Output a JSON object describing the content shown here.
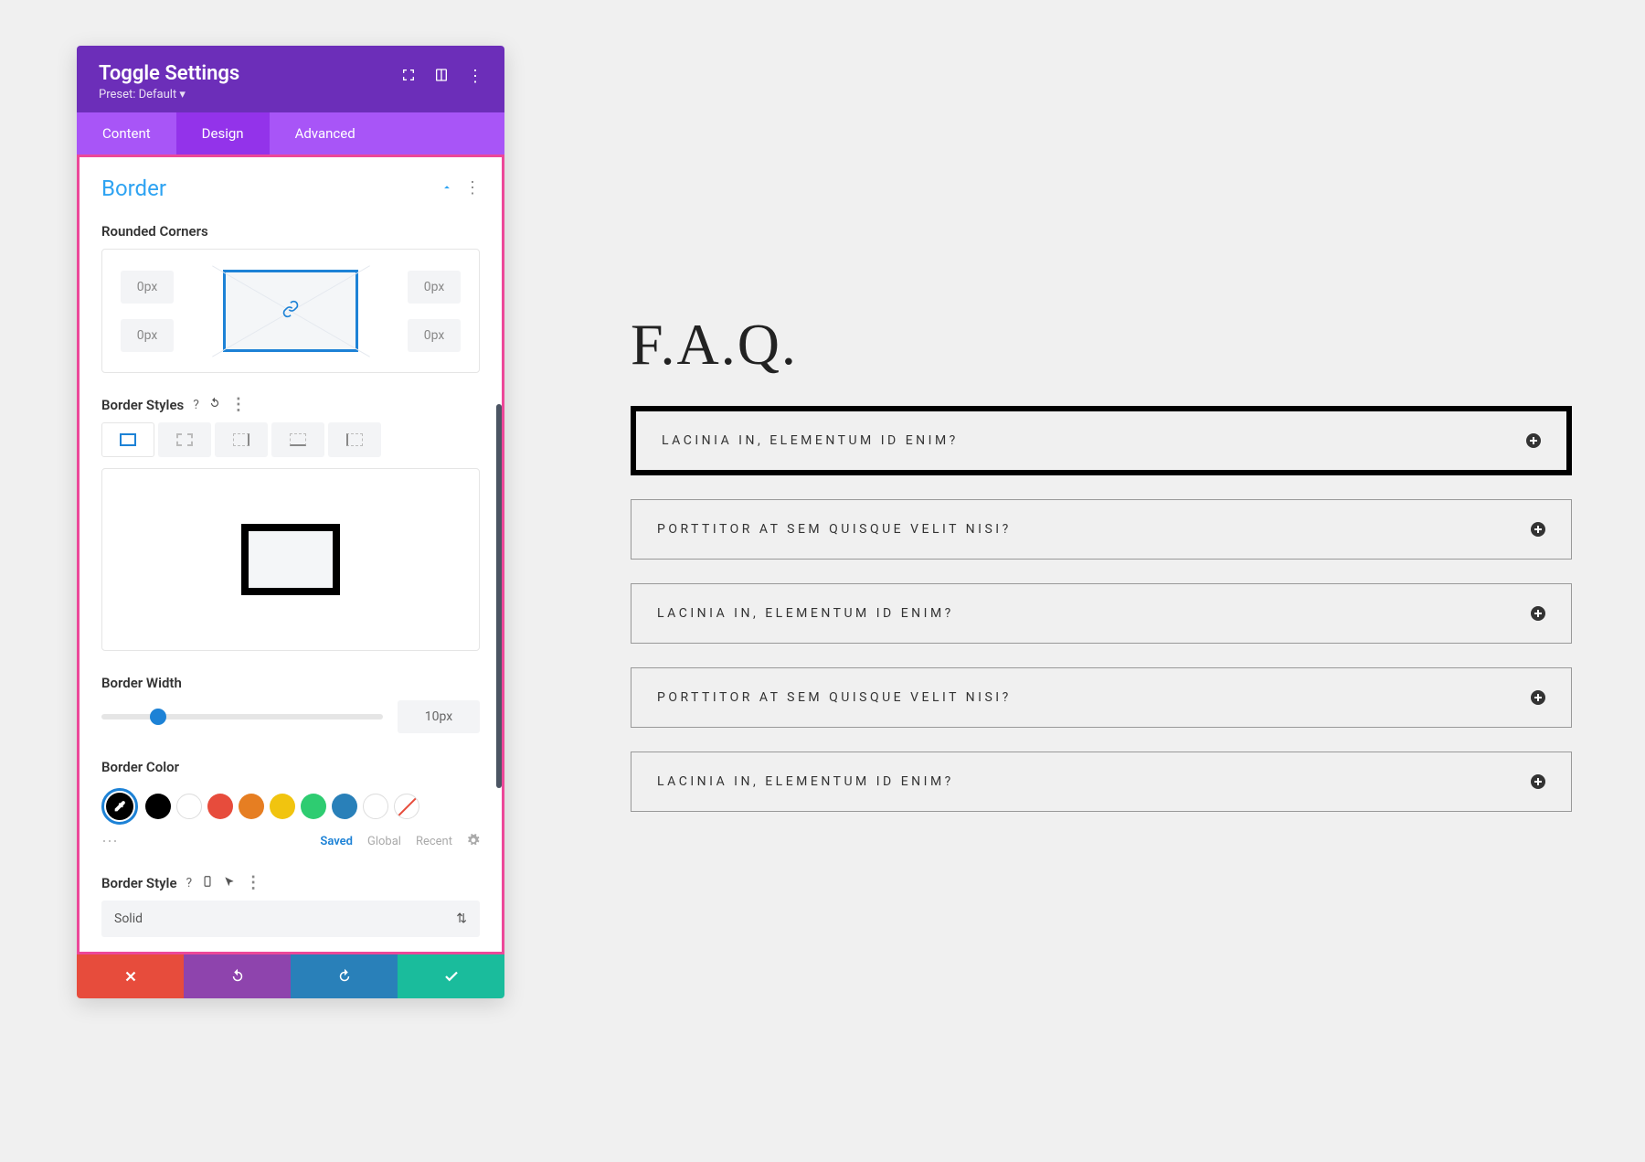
{
  "panel": {
    "title": "Toggle Settings",
    "preset": "Preset: Default ▾",
    "tabs": [
      "Content",
      "Design",
      "Advanced"
    ],
    "section": "Border",
    "rounded_label": "Rounded Corners",
    "corner": {
      "tl": "0px",
      "tr": "0px",
      "bl": "0px",
      "br": "0px"
    },
    "styles_label": "Border Styles",
    "width_label": "Border Width",
    "width_value": "10px",
    "color_label": "Border Color",
    "swatch_colors": [
      "#000000",
      "#ffffff",
      "#e74c3c",
      "#e67e22",
      "#f1c40f",
      "#2ecc71",
      "#2980b9",
      "#ffffff"
    ],
    "color_opts": {
      "saved": "Saved",
      "global": "Global",
      "recent": "Recent"
    },
    "style_label": "Border Style",
    "style_value": "Solid"
  },
  "preview": {
    "title": "F.A.Q.",
    "items": [
      {
        "label": "LACINIA IN, ELEMENTUM ID ENIM?",
        "thick": true
      },
      {
        "label": "PORTTITOR AT SEM QUISQUE VELIT NISI?",
        "thick": false
      },
      {
        "label": "LACINIA IN, ELEMENTUM ID ENIM?",
        "thick": false
      },
      {
        "label": "PORTTITOR AT SEM QUISQUE VELIT NISI?",
        "thick": false
      },
      {
        "label": "LACINIA IN, ELEMENTUM ID ENIM?",
        "thick": false
      }
    ]
  }
}
